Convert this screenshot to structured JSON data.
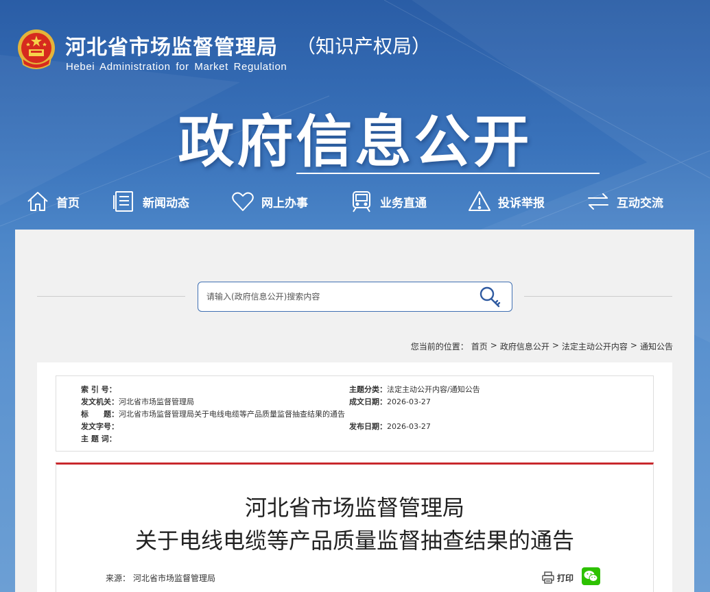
{
  "header": {
    "site_title": "河北省市场监督管理局",
    "site_subtitle": "（知识产权局）",
    "site_english": "Hebei Administration for Market Regulation",
    "big_title": "政府信息公开"
  },
  "nav": [
    {
      "label": "首页",
      "icon": "home-icon"
    },
    {
      "label": "新闻动态",
      "icon": "news-icon"
    },
    {
      "label": "网上办事",
      "icon": "heart-icon"
    },
    {
      "label": "业务直通",
      "icon": "train-icon"
    },
    {
      "label": "投诉举报",
      "icon": "warning-icon"
    },
    {
      "label": "互动交流",
      "icon": "exchange-icon"
    }
  ],
  "search": {
    "placeholder": "请输入(政府信息公开)搜索内容"
  },
  "breadcrumb": {
    "prefix": "您当前的位置：",
    "items": [
      "首页",
      "政府信息公开",
      "法定主动公开内容",
      "通知公告"
    ],
    "separator": ">"
  },
  "meta": {
    "index_label": "索 引 号：",
    "index_value": "",
    "issuer_label": "发文机关：",
    "issuer_value": "河北省市场监督管理局",
    "title_label": "标　　题：",
    "title_value": "河北省市场监督管理局关于电线电缆等产品质量监督抽查结果的通告",
    "doc_no_label": "发文字号：",
    "doc_no_value": "",
    "keywords_label": "主 题 词：",
    "keywords_value": "",
    "category_label": "主题分类：",
    "category_value": "法定主动公开内容/通知公告",
    "created_label": "成文日期：",
    "created_value": "2026-03-27",
    "published_label": "发布日期：",
    "published_value": "2026-03-27"
  },
  "article": {
    "title_line1": "河北省市场监督管理局",
    "title_line2": "关于电线电缆等产品质量监督抽查结果的通告",
    "source_label": "来源：",
    "source_value": "河北省市场监督管理局",
    "print_label": "打印"
  },
  "colors": {
    "accent_red": "#c8282d",
    "search_border": "#3f6fb2",
    "wechat_green": "#2dc100"
  }
}
